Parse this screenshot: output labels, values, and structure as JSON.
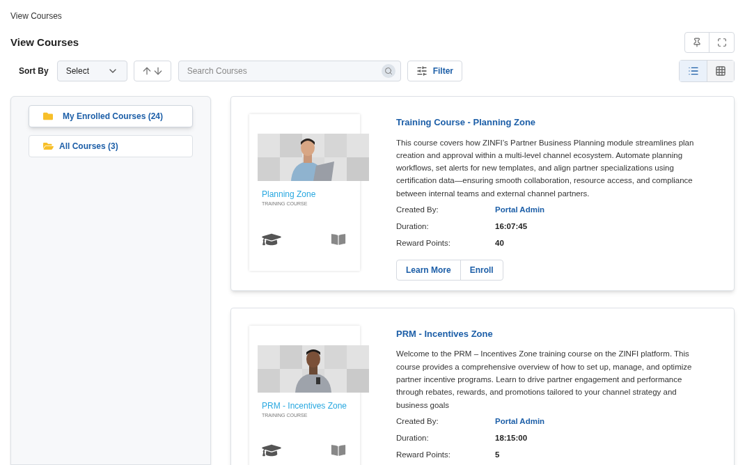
{
  "breadcrumb": "View Courses",
  "page_title": "View Courses",
  "toolbar": {
    "sort_label": "Sort By",
    "sort_select": "Select",
    "search": {
      "placeholder": "Search Courses"
    },
    "filter_button": "Filter",
    "view_modes": [
      {
        "kind": "list",
        "selected": true
      },
      {
        "kind": "grid",
        "selected": false
      }
    ]
  },
  "sidebar": {
    "items": [
      {
        "label": "My Enrolled Courses (24)",
        "selected": true
      },
      {
        "label": "All Courses (3)",
        "selected": false
      }
    ]
  },
  "courses": [
    {
      "title": "Training Course - Planning Zone",
      "thumbnail": {
        "title": "Planning Zone",
        "subtitle": "TRAINING COURSE"
      },
      "description": "This course covers how ZINFI’s Partner Business Planning module streamlines plan creation and approval within a multi-level channel ecosystem. Automate planning workflows, set alerts for new templates, and align partner specializations using certification data—ensuring smooth collaboration, resource access, and compliance between internal teams and external channel partners.",
      "details": [
        {
          "label": "Created By:",
          "value": "Portal Admin",
          "kind": "link"
        },
        {
          "label": "Duration:",
          "value": "16:07:45",
          "kind": "text"
        },
        {
          "label": "Reward Points:",
          "value": "40",
          "kind": "text"
        }
      ],
      "buttons": [
        "Learn More",
        "Enroll"
      ]
    },
    {
      "title": "PRM - Incentives Zone",
      "thumbnail": {
        "title": "PRM - Incentives Zone",
        "subtitle": "TRAINING COURSE"
      },
      "description": "Welcome to the PRM – Incentives Zone training course on the ZINFI platform. This course provides a comprehensive overview of how to set up, manage, and optimize partner incentive programs. Learn to drive partner engagement and performance through rebates, rewards, and promotions tailored to your channel strategy and business goals",
      "details": [
        {
          "label": "Created By:",
          "value": "Portal Admin",
          "kind": "link"
        },
        {
          "label": "Duration:",
          "value": "18:15:00",
          "kind": "text"
        },
        {
          "label": "Reward Points:",
          "value": "5",
          "kind": "text"
        }
      ]
    }
  ]
}
